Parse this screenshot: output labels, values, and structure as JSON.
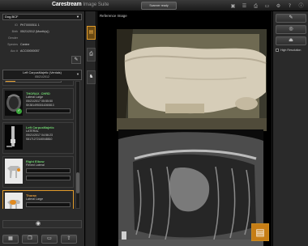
{
  "app": {
    "brand": "Carestream",
    "product": "Image Suite"
  },
  "toolbar": {
    "scanner_status": "Scanner ready"
  },
  "patient_select": {
    "value": "Dog,BCF"
  },
  "patient": {
    "rows": [
      {
        "key": "ID",
        "value": "PKT0000511 1"
      },
      {
        "key": "Birth",
        "value": "05/21/2012 (Month(s))"
      },
      {
        "key": "Gender",
        "value": ""
      },
      {
        "key": "Species",
        "value": "Canine"
      },
      {
        "key": "Acc #",
        "value": "ACC00000057"
      }
    ]
  },
  "exam_select": {
    "line1": "Left CarpusMajetic (Ventals)",
    "line2": "05/21/2012"
  },
  "thumbnails": [
    {
      "title": "THORAX_CHRD",
      "line1": "Lateral Large",
      "line2": "05/21/2017 05:55:50",
      "line3": "SK3814953014260813",
      "title_color": "green"
    },
    {
      "title": "Left CarpusMajetic",
      "line1": "LATERAL",
      "line2": "05/21/2017 04:56:23",
      "line3": "S8171272140048810",
      "title_color": "green"
    },
    {
      "title": "Right Elbow",
      "line1": "Flexed Lateral",
      "title_color": "green"
    },
    {
      "title": "Thorax",
      "line1": "Lateral Large",
      "title_color": "amber"
    }
  ],
  "viewer": {
    "reference_label": "Reference Image"
  },
  "right_panel": {
    "high_resolution_label": "High Resolution"
  },
  "icons": {
    "top": [
      "folder-icon",
      "list-icon",
      "printer-icon",
      "display-icon",
      "settings-icon",
      "help-icon",
      "info-icon"
    ],
    "strip": [
      "photo-icon",
      "printer-icon",
      "dog-icon"
    ],
    "left_tools": [
      "grid-icon",
      "copy-icon",
      "monitor-icon",
      "share-icon"
    ],
    "right_tools": [
      "pencil-icon",
      "circle-icon",
      "eject-icon"
    ]
  },
  "colors": {
    "accent": "#e09a2a",
    "status_green": "#6fd16f",
    "status_amber": "#e8a040"
  }
}
